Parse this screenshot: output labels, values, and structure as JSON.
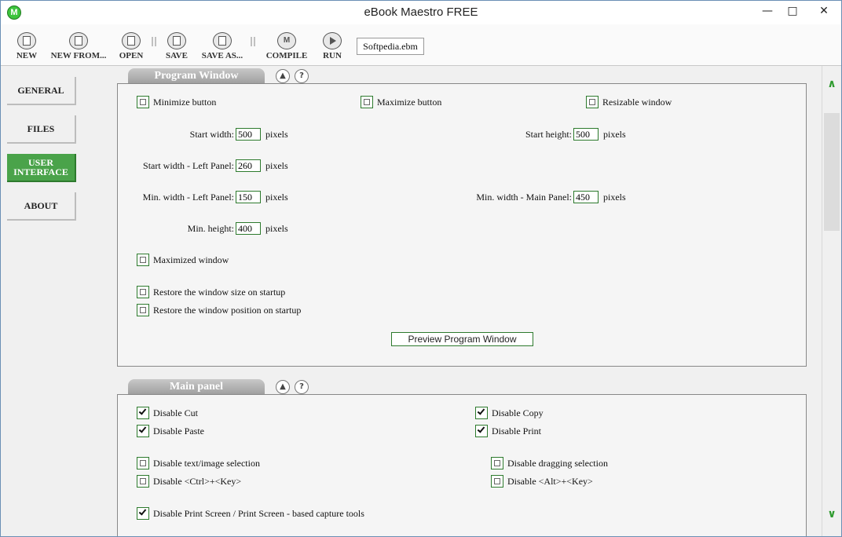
{
  "window": {
    "title": "eBook Maestro FREE",
    "logo_letter": "M"
  },
  "window_controls": {
    "minimize": "—",
    "maximize": "□",
    "close": "✕"
  },
  "toolbar": {
    "new_label": "NEW",
    "new_from_label": "NEW FROM...",
    "open_label": "OPEN",
    "save_label": "SAVE",
    "save_as_label": "SAVE AS...",
    "compile_label": "COMPILE",
    "run_label": "RUN",
    "compile_icon_letter": "M",
    "file_name": "Softpedia.ebm"
  },
  "sidebar": {
    "items": [
      {
        "label": "GENERAL"
      },
      {
        "label": "FILES"
      },
      {
        "label": "USER\nINTERFACE",
        "active": true
      },
      {
        "label": "ABOUT"
      }
    ]
  },
  "program_window": {
    "tab_label": "Program Window",
    "collapse_glyph": "▲",
    "help_glyph": "?",
    "minimize_button": {
      "label": "Minimize button",
      "checked": false
    },
    "maximize_button": {
      "label": "Maximize button",
      "checked": false
    },
    "resizable_window": {
      "label": "Resizable window",
      "checked": false
    },
    "start_width": {
      "label": "Start width:",
      "value": "500",
      "unit": "pixels"
    },
    "start_height": {
      "label": "Start height:",
      "value": "500",
      "unit": "pixels"
    },
    "start_width_left": {
      "label": "Start width - Left Panel:",
      "value": "260",
      "unit": "pixels"
    },
    "min_width_left": {
      "label": "Min. width - Left Panel:",
      "value": "150",
      "unit": "pixels"
    },
    "min_width_main": {
      "label": "Min. width - Main Panel:",
      "value": "450",
      "unit": "pixels"
    },
    "min_height": {
      "label": "Min. height:",
      "value": "400",
      "unit": "pixels"
    },
    "maximized_window": {
      "label": "Maximized window",
      "checked": false
    },
    "restore_size": {
      "label": "Restore the window size on startup",
      "checked": false
    },
    "restore_position": {
      "label": "Restore the window position on startup",
      "checked": false
    },
    "preview_button": "Preview Program Window"
  },
  "main_panel": {
    "tab_label": "Main panel",
    "collapse_glyph": "▲",
    "help_glyph": "?",
    "disable_cut": {
      "label": "Disable Cut",
      "checked": true
    },
    "disable_copy": {
      "label": "Disable Copy",
      "checked": true
    },
    "disable_paste": {
      "label": "Disable Paste",
      "checked": true
    },
    "disable_print": {
      "label": "Disable Print",
      "checked": true
    },
    "disable_selection": {
      "label": "Disable text/image selection",
      "checked": false
    },
    "disable_dragging": {
      "label": "Disable dragging selection",
      "checked": false
    },
    "disable_ctrl": {
      "label": "Disable <Ctrl>+<Key>",
      "checked": false
    },
    "disable_alt": {
      "label": "Disable <Alt>+<Key>",
      "checked": false
    },
    "disable_print_screen": {
      "label": "Disable Print Screen / Print Screen - based capture tools",
      "checked": true
    }
  },
  "scrollbar": {
    "up_glyph": "∧",
    "down_glyph": "∨"
  },
  "colors": {
    "accent_green": "#4aa34a",
    "border_green": "#2d7a2d",
    "tab_gray": "#a8a8a8"
  }
}
